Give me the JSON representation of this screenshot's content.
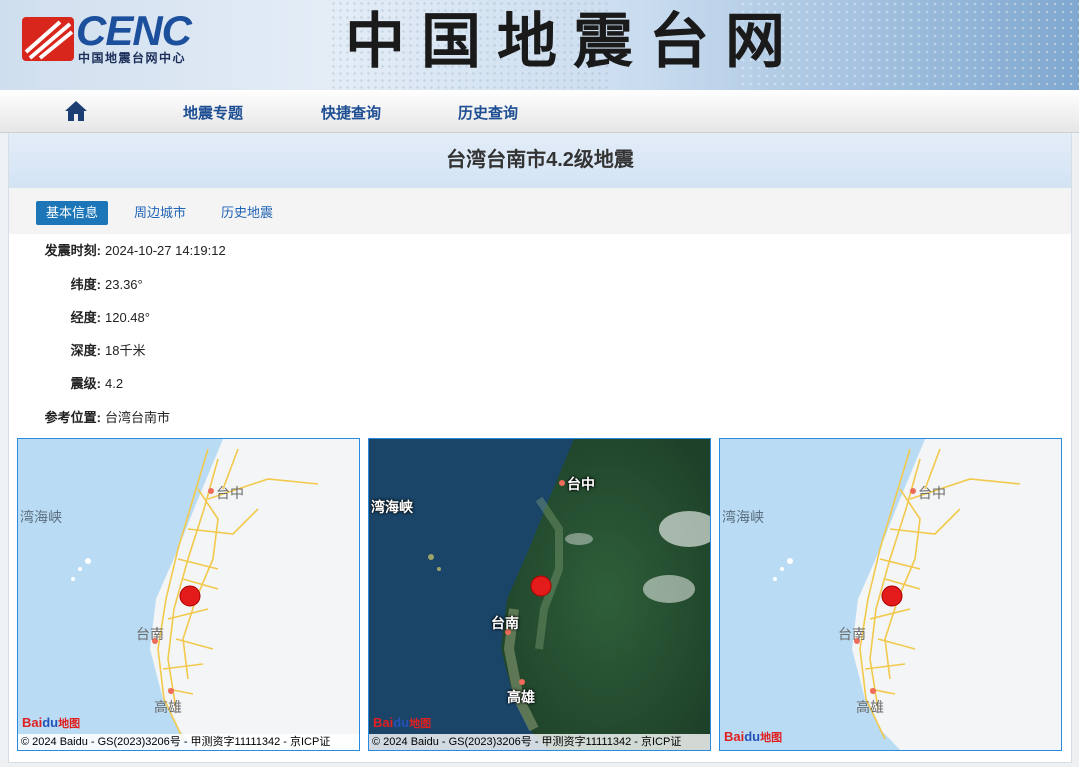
{
  "header": {
    "logo_text": "CENC",
    "logo_sub": "中国地震台网中心",
    "site_title": "中国地震台网"
  },
  "nav": {
    "home_icon": "home-icon",
    "items": [
      "地震专题",
      "快捷查询",
      "历史查询"
    ]
  },
  "event": {
    "title": "台湾台南市4.2级地震"
  },
  "tabs": [
    "基本信息",
    "周边城市",
    "历史地震"
  ],
  "info": [
    {
      "label": "发震时刻:",
      "value": "2024-10-27 14:19:12"
    },
    {
      "label": "纬度:",
      "value": "23.36°"
    },
    {
      "label": "经度:",
      "value": "120.48°"
    },
    {
      "label": "深度:",
      "value": "18千米"
    },
    {
      "label": "震级:",
      "value": "4.2"
    },
    {
      "label": "参考位置:",
      "value": "台湾台南市"
    }
  ],
  "maps": {
    "labels": {
      "taizhong": "台中",
      "tainan": "台南",
      "gaoxiong": "高雄",
      "strait": "湾海峡"
    },
    "baidu": {
      "b1": "Bai",
      "b2": "du",
      "b3": "地图"
    },
    "copyright": "© 2024 Baidu - GS(2023)3206号 - 甲测资字11111342 - 京ICP证"
  },
  "colors": {
    "accent": "#1d76b8",
    "nav_text": "#1e4e93",
    "map_sea": "#b9dbf3",
    "map_land": "#eef0f2",
    "marker": "#e41b1b"
  }
}
